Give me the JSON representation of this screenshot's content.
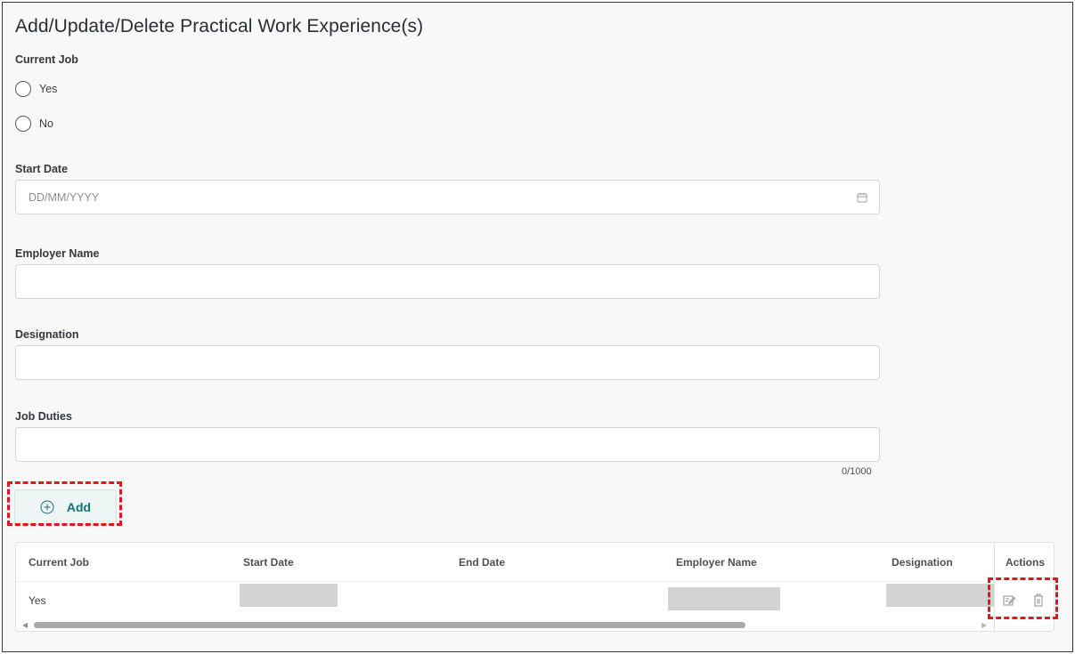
{
  "page": {
    "title": "Add/Update/Delete Practical Work Experience(s)"
  },
  "form": {
    "current_job": {
      "label": "Current Job",
      "options": [
        "Yes",
        "No"
      ]
    },
    "start_date": {
      "label": "Start Date",
      "placeholder": "DD/MM/YYYY",
      "icon": "calendar-icon"
    },
    "employer_name": {
      "label": "Employer Name",
      "value": ""
    },
    "designation": {
      "label": "Designation",
      "value": ""
    },
    "job_duties": {
      "label": "Job Duties",
      "value": "",
      "counter": "0/1000"
    },
    "add_button": {
      "label": "Add",
      "icon": "plus-circle-icon"
    }
  },
  "table": {
    "columns": [
      "Current Job",
      "Start Date",
      "End Date",
      "Employer Name",
      "Designation"
    ],
    "actions_header": "Actions",
    "rows": [
      {
        "current_job": "Yes",
        "start_date": "",
        "end_date": "",
        "employer_name": "",
        "designation": ""
      }
    ],
    "row_actions": [
      "edit-icon",
      "delete-icon"
    ]
  },
  "colors": {
    "accent": "#11707a",
    "highlight": "#e0171e",
    "redaction": "#d3d3d3"
  }
}
